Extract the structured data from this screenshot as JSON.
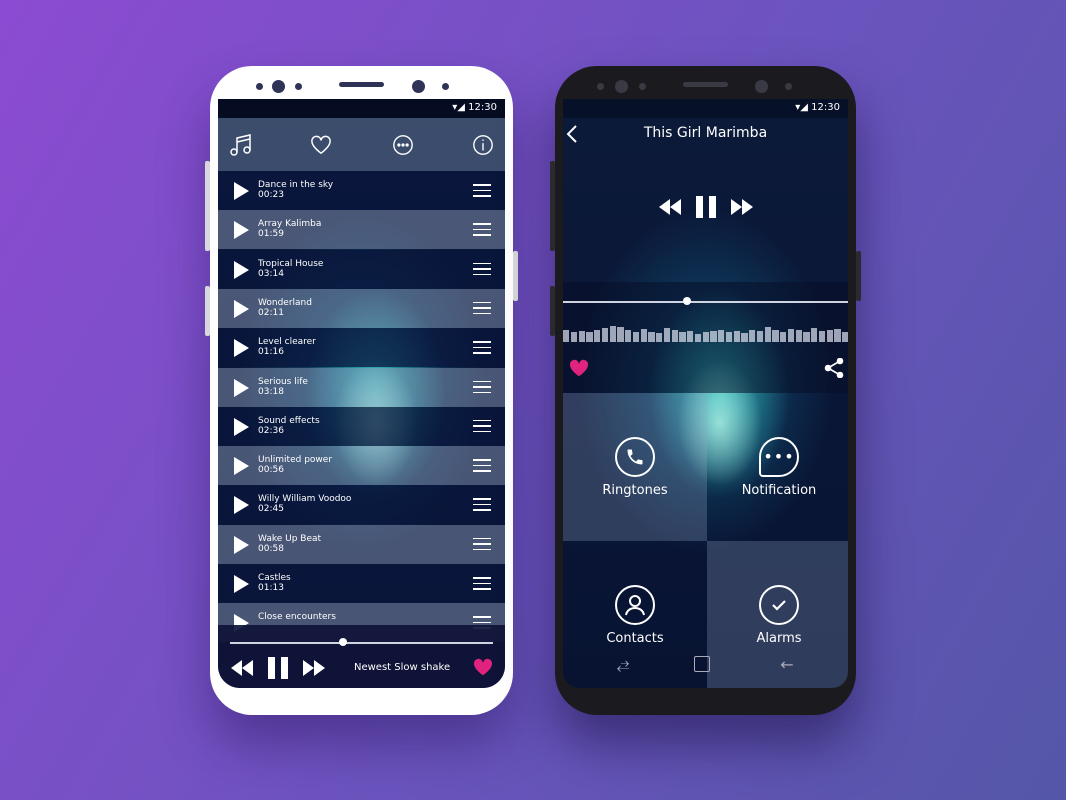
{
  "status": {
    "time": "12:30"
  },
  "left": {
    "toolbar_icons": [
      "music-note-icon",
      "heart-icon",
      "more-icon",
      "info-icon"
    ],
    "songs": [
      {
        "title": "Dance in the sky",
        "duration": "00:23"
      },
      {
        "title": "Array Kalimba",
        "duration": "01:59"
      },
      {
        "title": "Tropical House",
        "duration": "03:14"
      },
      {
        "title": "Wonderland",
        "duration": "02:11"
      },
      {
        "title": "Level clearer",
        "duration": "01:16"
      },
      {
        "title": "Serious life",
        "duration": "03:18"
      },
      {
        "title": "Sound effects",
        "duration": "02:36"
      },
      {
        "title": "Unlimited power",
        "duration": "00:56"
      },
      {
        "title": "Willy William Voodoo",
        "duration": "02:45"
      },
      {
        "title": "Wake Up Beat",
        "duration": "00:58"
      },
      {
        "title": "Castles",
        "duration": "01:13"
      },
      {
        "title": "Close encounters",
        "duration": ""
      }
    ],
    "player": {
      "now_playing": "Newest Slow shake",
      "progress_percent": 43
    }
  },
  "right": {
    "title": "This Girl Marimba",
    "progress_percent": 43,
    "equalizer": [
      0.6,
      0.5,
      0.55,
      0.5,
      0.6,
      0.7,
      0.8,
      0.75,
      0.6,
      0.5,
      0.65,
      0.5,
      0.45,
      0.7,
      0.6,
      0.5,
      0.55,
      0.4,
      0.5,
      0.55,
      0.6,
      0.5,
      0.55,
      0.45,
      0.6,
      0.55,
      0.75,
      0.6,
      0.5,
      0.65,
      0.6,
      0.5,
      0.7,
      0.55,
      0.6,
      0.65,
      0.5
    ],
    "tiles": [
      {
        "label": "Ringtones"
      },
      {
        "label": "Notification"
      },
      {
        "label": "Contacts"
      },
      {
        "label": "Alarms"
      }
    ]
  },
  "colors": {
    "accent": "#e0237e",
    "background": "#7a50c8"
  }
}
